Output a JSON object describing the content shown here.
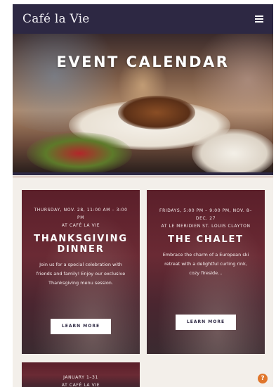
{
  "header": {
    "brand": "Café la Vie",
    "menu_icon": "hamburger-menu-icon"
  },
  "hero": {
    "title": "EVENT CALENDAR"
  },
  "events": [
    {
      "meta_line1": "THURSDAY, NOV. 28, 11:00 AM – 3:00 PM",
      "meta_line2": "AT CAFÉ LA VIE",
      "title": "THANKSGIVING DINNER",
      "description": "Join us for a special celebration with friends and family! Enjoy our exclusive Thanksgiving menu session.",
      "button_label": "LEARN MORE"
    },
    {
      "meta_line1": "FRIDAYS, 5:00 PM – 9:00 PM, NOV. 8–DEC. 27",
      "meta_line2": "AT LE MERIDIEN ST. LOUIS CLAYTON",
      "title": "THE CHALET",
      "description": "Embrace the charm of a European ski retreat with a delightful curling rink, cozy fireside…",
      "button_label": "LEARN MORE"
    },
    {
      "meta_line1": "JANUARY 1–31",
      "meta_line2": "AT CAFÉ LA VIE"
    }
  ],
  "help_button": {
    "icon": "help-icon",
    "label": "?"
  },
  "colors": {
    "header_bg": "#2d2843",
    "card_bg": "#5b1f2a",
    "accent": "#e0762c"
  }
}
